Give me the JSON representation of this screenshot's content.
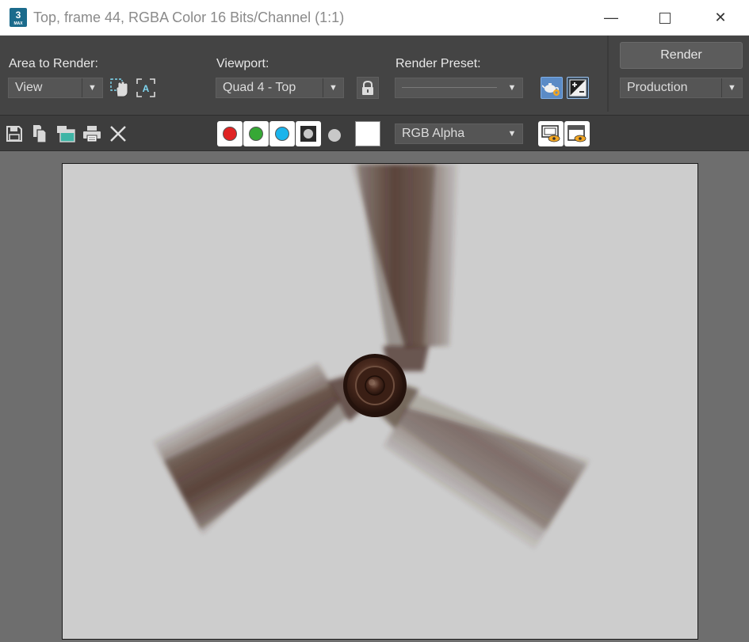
{
  "window": {
    "title": "Top, frame 44, RGBA Color 16 Bits/Channel (1:1)",
    "app_icon_number": "3",
    "app_icon_caption": "MAX",
    "minimize_glyph": "—",
    "close_glyph": "✕"
  },
  "toolbar": {
    "area_label": "Area to Render:",
    "area_value": "View",
    "viewport_label": "Viewport:",
    "viewport_value": "Quad 4 - Top",
    "preset_label": "Render Preset:",
    "preset_value": "",
    "render_button": "Render",
    "production_value": "Production",
    "dropdown_arrow": "▼"
  },
  "channels": {
    "display_value": "RGB Alpha",
    "colors": {
      "red": "#e02323",
      "green": "#36a835",
      "blue": "#1ab4ec",
      "swatch": "#ffffff"
    }
  },
  "icons": [
    "save-icon",
    "copy-icon",
    "clone-window-icon",
    "print-icon",
    "clear-icon",
    "region-icon",
    "hand-pan-icon",
    "auto-region-icon",
    "lock-icon",
    "teapot-settings-icon",
    "exposure-icon",
    "display-toggle-icon",
    "info-panel-icon"
  ],
  "render_frame": {
    "background": "#cdcdcd",
    "blade_color": "#4a2e22",
    "hub_color": "#3b2219"
  }
}
